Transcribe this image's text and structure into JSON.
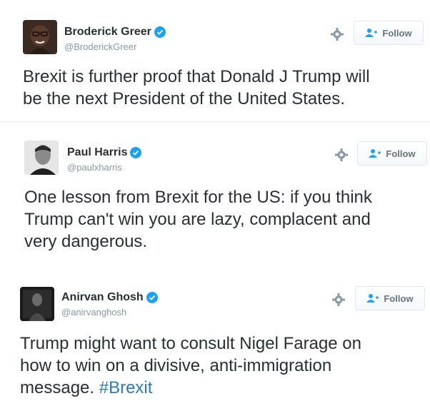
{
  "tweets": [
    {
      "name": "Broderick Greer",
      "handle": "@BroderickGreer",
      "follow_label": "Follow",
      "text": "Brexit is further proof that Donald J Trump will\nbe the next President of the United States.",
      "avatar_icon": "person-photo-glasses"
    },
    {
      "name": "Paul Harris",
      "handle": "@paulxharris",
      "follow_label": "Follow",
      "text": "One lesson from Brexit for the US: if you think\nTrump can't win you are lazy, complacent and\nvery dangerous.",
      "avatar_icon": "person-photo-bw"
    },
    {
      "name": "Anirvan Ghosh",
      "handle": "@anirvanghosh",
      "follow_label": "Follow",
      "text_main": "Trump might want to consult Nigel Farage on\nhow to win on a divisive, anti-immigration\nmessage. ",
      "hashtag": "#Brexit",
      "avatar_icon": "person-photo-dark"
    }
  ],
  "colors": {
    "verified": "#1da1f2",
    "hashtag": "#2b7bb9",
    "follow_icon": "#1da1f2"
  }
}
